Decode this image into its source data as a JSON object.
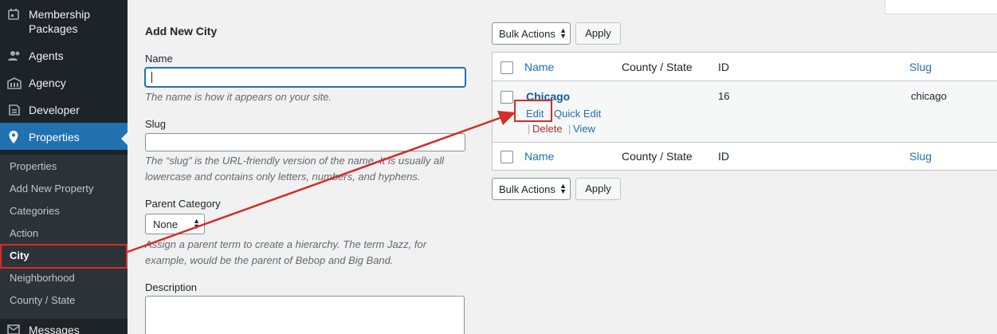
{
  "sidebar": {
    "items": [
      {
        "label": "Membership Packages",
        "icon": "calendar-icon"
      },
      {
        "label": "Agents",
        "icon": "users-icon"
      },
      {
        "label": "Agency",
        "icon": "building-icon"
      },
      {
        "label": "Developer",
        "icon": "code-icon"
      },
      {
        "label": "Properties",
        "icon": "location-pin-icon"
      },
      {
        "label": "Messages",
        "icon": "mail-icon"
      }
    ],
    "membership_line1": "Membership",
    "membership_line2": "Packages",
    "submenu": [
      "Properties",
      "Add New Property",
      "Categories",
      "Action",
      "City",
      "Neighborhood",
      "County / State"
    ]
  },
  "form": {
    "title": "Add New City",
    "name_label": "Name",
    "name_help": "The name is how it appears on your site.",
    "slug_label": "Slug",
    "slug_help_line1": "The “slug” is the URL-friendly version of the name. It is usually all",
    "slug_help_line2": "lowercase and contains only letters, numbers, and hyphens.",
    "parent_label": "Parent Category",
    "parent_value": "None",
    "parent_help_line1": "Assign a parent term to create a hierarchy. The term Jazz, for",
    "parent_help_line2": "example, would be the parent of Bebop and Big Band.",
    "description_label": "Description"
  },
  "table": {
    "bulk_actions": "Bulk Actions",
    "apply": "Apply",
    "columns": [
      "Name",
      "County / State",
      "ID",
      "Slug"
    ],
    "rows": [
      {
        "name": "Chicago",
        "county": "",
        "id": "16",
        "slug": "chicago"
      }
    ],
    "row_actions": {
      "edit": "Edit",
      "quick_edit": "Quick Edit",
      "delete": "Delete",
      "view": "View",
      "separator": "|"
    }
  },
  "colors": {
    "accent": "#2271b1",
    "sidebar": "#1d2327",
    "annotation": "#d52b2b"
  }
}
